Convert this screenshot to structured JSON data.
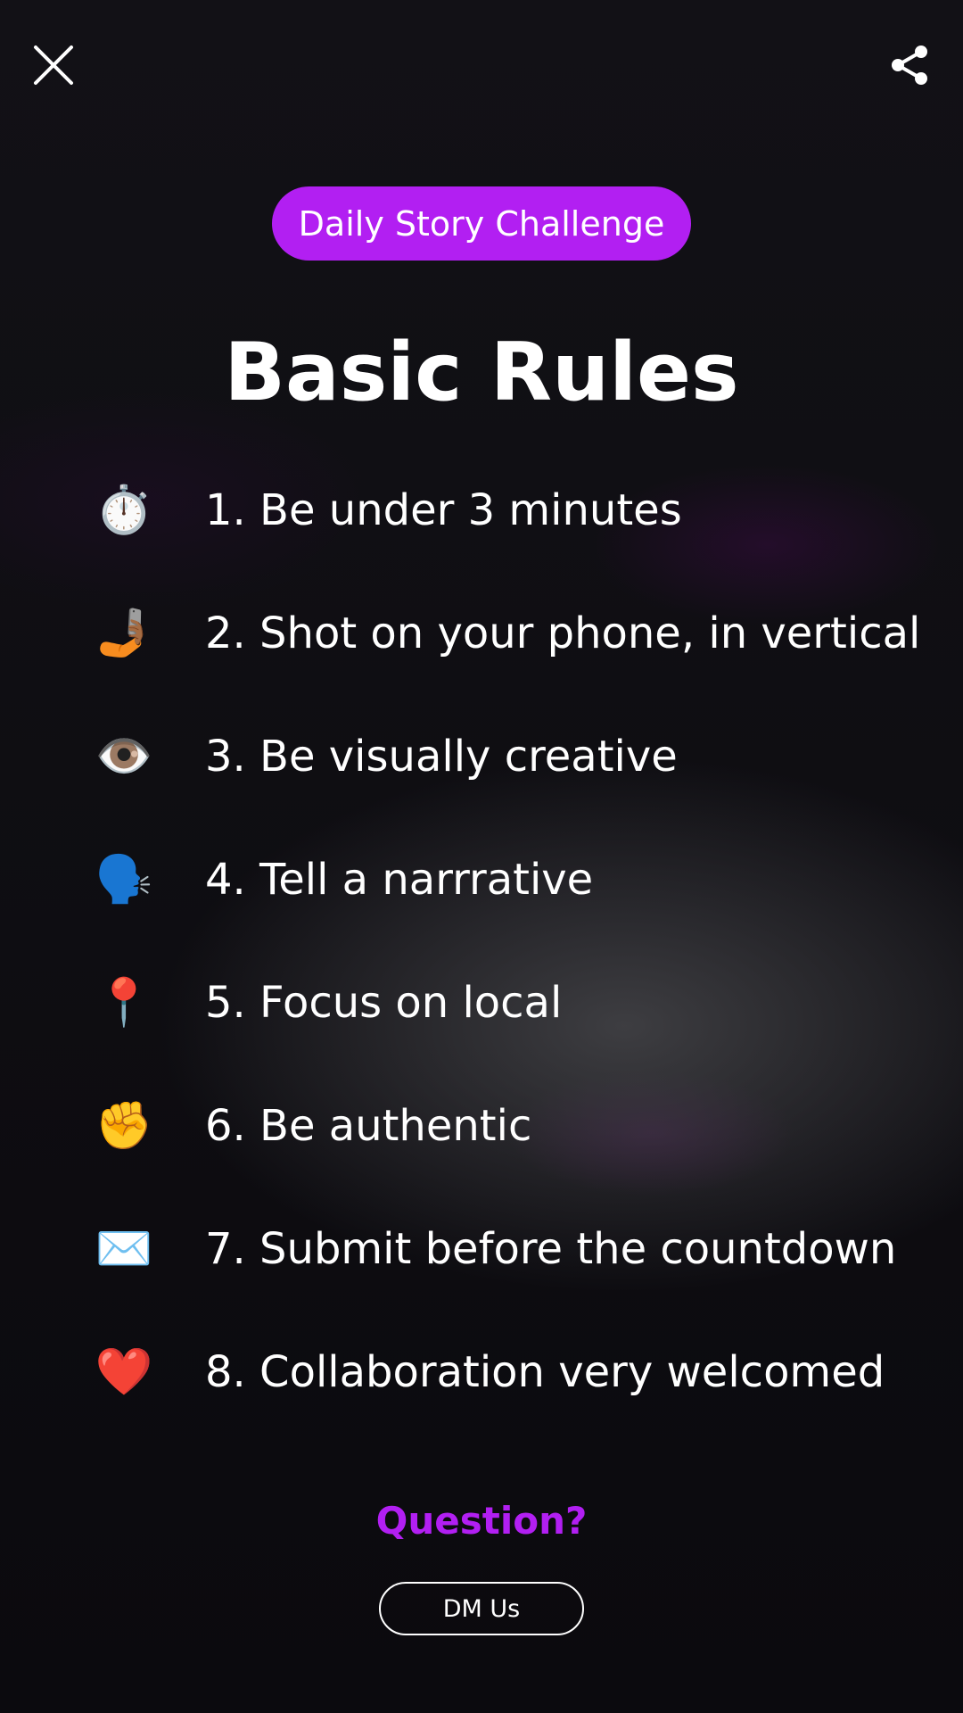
{
  "header": {
    "close_icon": "close-icon",
    "share_icon": "share-icon"
  },
  "badge": {
    "label": "Daily Story Challenge",
    "color": "#b21ff2"
  },
  "title": "Basic Rules",
  "rules": [
    {
      "icon": "stopwatch-icon",
      "glyph": "⏱️",
      "text": "1. Be under 3 minutes"
    },
    {
      "icon": "selfie-icon",
      "glyph": "🤳🏾",
      "text": "2. Shot on your phone, in vertical"
    },
    {
      "icon": "eye-icon",
      "glyph": "👁️",
      "text": "3. Be visually creative"
    },
    {
      "icon": "speaking-head-icon",
      "glyph": "🗣️",
      "text": "4. Tell a narrrative"
    },
    {
      "icon": "pushpin-icon",
      "glyph": "📍",
      "text": "5. Focus on local"
    },
    {
      "icon": "raised-fist-icon",
      "glyph": "✊",
      "text": "6. Be authentic"
    },
    {
      "icon": "envelope-icon",
      "glyph": "✉️",
      "text": "7. Submit before the countdown"
    },
    {
      "icon": "heart-icon",
      "glyph": "❤️",
      "text": "8. Collaboration very welcomed"
    }
  ],
  "footer": {
    "question": "Question?",
    "dm_button": "DM Us",
    "accent_color": "#b21ff2"
  }
}
